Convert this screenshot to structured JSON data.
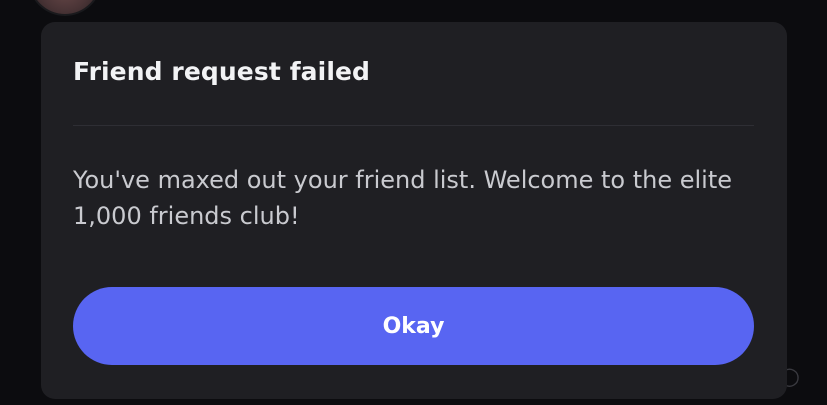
{
  "dialog": {
    "title": "Friend request failed",
    "message": "You've maxed out your friend list. Welcome to the elite 1,000 friends club!",
    "confirm_label": "Okay"
  },
  "colors": {
    "background": "#0c0c0f",
    "modal": "#1f1f23",
    "accent": "#5865f2",
    "title_text": "#f2f3f5",
    "body_text": "#c9cacf"
  }
}
